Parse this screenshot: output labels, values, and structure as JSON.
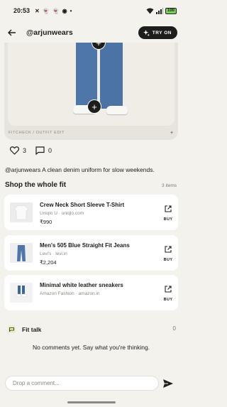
{
  "status_bar": {
    "time": "20:53",
    "icons": [
      "vpn-icon",
      "snapchat-icon",
      "snapchat-icon",
      "record-icon",
      "dot-icon"
    ],
    "battery": "100",
    "indicator_dot": "•"
  },
  "header": {
    "handle": "@arjunwears",
    "try_on_label": "TRY ON"
  },
  "photo": {
    "caption": "FITCHECK  /  OUTFIT EDIT",
    "plus_glyph": "+"
  },
  "reactions": {
    "likes": "3",
    "comments": "0"
  },
  "post": {
    "caption": "@arjunwears A clean denim uniform for slow weekends."
  },
  "shop": {
    "title": "Shop the whole fit",
    "count": "3 items",
    "products": [
      {
        "name": "Crew Neck Short Sleeve T-Shirt",
        "meta": "Uniqlo U · uniqlo.com",
        "price": "₹990",
        "buy_label": "BUY"
      },
      {
        "name": "Men's 505 Blue Straight Fit Jeans",
        "meta": "Levi's · levi.in",
        "price": "₹2,204",
        "buy_label": "BUY"
      },
      {
        "name": "Minimal white leather sneakers",
        "meta": "Amazon Fashion · amazon.in",
        "buy_label": "BUY"
      }
    ]
  },
  "fit_talk": {
    "title": "Fit talk",
    "count": "0",
    "empty_message": "No comments yet. Say what you're thinking."
  },
  "comment_box": {
    "placeholder": "Drop a comment..."
  },
  "colors": {
    "background": "#f3f2ed",
    "accent": "#1d1d1b",
    "denim": "#4f76a8",
    "chat_badge": "#e9f0c4"
  }
}
